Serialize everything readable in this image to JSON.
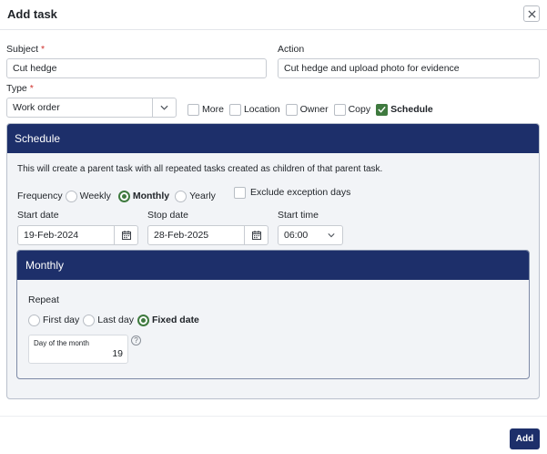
{
  "dialog": {
    "title": "Add task",
    "close_icon": "close-icon"
  },
  "form": {
    "subject_label": "Subject",
    "subject_value": "Cut hedge",
    "action_label": "Action",
    "action_value": "Cut hedge and upload photo for evidence",
    "type_label": "Type",
    "type_value": "Work order",
    "required_marker": "*"
  },
  "options": [
    {
      "label": "More",
      "checked": false
    },
    {
      "label": "Location",
      "checked": false
    },
    {
      "label": "Owner",
      "checked": false
    },
    {
      "label": "Copy",
      "checked": false
    },
    {
      "label": "Schedule",
      "checked": true
    }
  ],
  "schedule": {
    "title": "Schedule",
    "description": "This will create a parent task with all repeated tasks created as children of that parent task.",
    "frequency_label": "Frequency",
    "frequency_options": [
      "Weekly",
      "Monthly",
      "Yearly"
    ],
    "frequency_selected": "Monthly",
    "exclude_label": "Exclude exception days",
    "start_date_label": "Start date",
    "start_date_value": "19-Feb-2024",
    "stop_date_label": "Stop date",
    "stop_date_value": "28-Feb-2025",
    "start_time_label": "Start time",
    "start_time_value": "06:00"
  },
  "monthly": {
    "title": "Monthly",
    "repeat_label": "Repeat",
    "repeat_options": [
      "First day",
      "Last day",
      "Fixed date"
    ],
    "repeat_selected": "Fixed date",
    "day_of_month_label": "Day of the month",
    "day_of_month_value": "19",
    "help_glyph": "?"
  },
  "footer": {
    "add_label": "Add"
  },
  "colors": {
    "header_navy": "#1d2f6a",
    "check_green": "#3f7a3f",
    "required_red": "#d0312d"
  }
}
